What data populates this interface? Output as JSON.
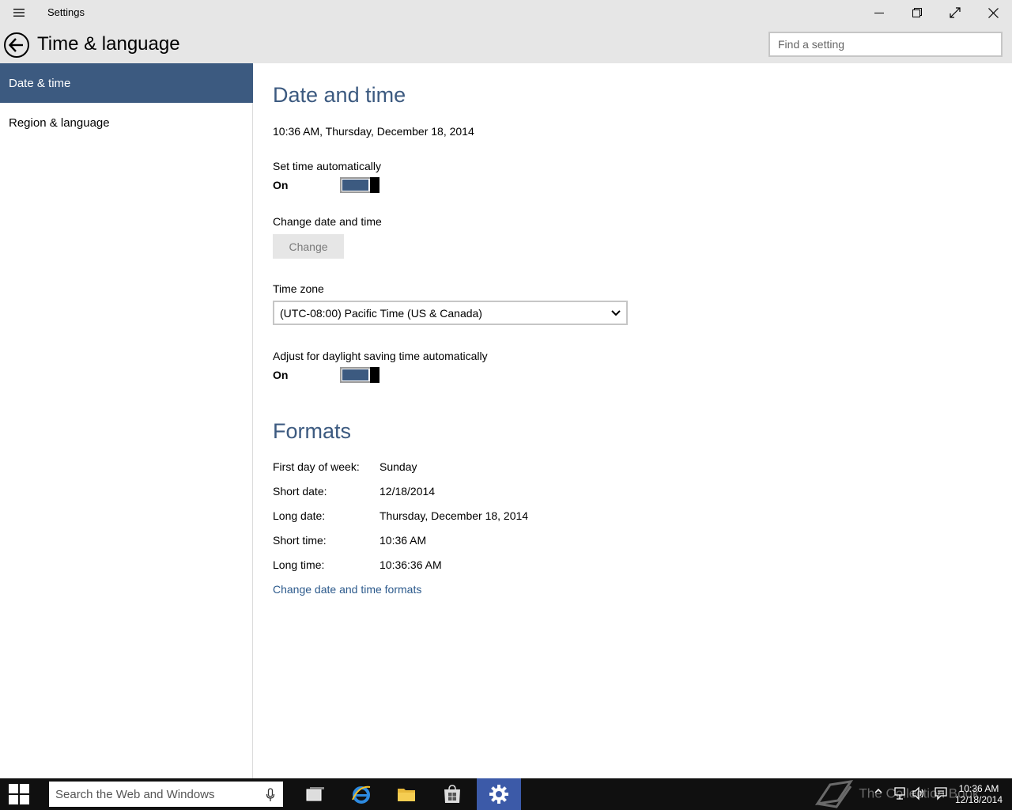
{
  "window": {
    "app_title": "Settings"
  },
  "header": {
    "page_title": "Time & language",
    "search_placeholder": "Find a setting"
  },
  "sidebar": {
    "items": [
      {
        "label": "Date & time",
        "active": true
      },
      {
        "label": "Region & language",
        "active": false
      }
    ]
  },
  "date_time": {
    "section_title": "Date and time",
    "current": "10:36 AM, Thursday, December 18, 2014",
    "set_time_auto": {
      "label": "Set time automatically",
      "state": "On"
    },
    "change_date_time": {
      "label": "Change date and time",
      "button": "Change"
    },
    "time_zone": {
      "label": "Time zone",
      "value": "(UTC-08:00) Pacific Time (US & Canada)"
    },
    "daylight": {
      "label": "Adjust for daylight saving time automatically",
      "state": "On"
    }
  },
  "formats": {
    "section_title": "Formats",
    "rows": [
      {
        "key": "First day of week:",
        "value": "Sunday"
      },
      {
        "key": "Short date:",
        "value": "12/18/2014"
      },
      {
        "key": "Long date:",
        "value": "Thursday, December 18, 2014"
      },
      {
        "key": "Short time:",
        "value": "10:36 AM"
      },
      {
        "key": "Long time:",
        "value": "10:36:36 AM"
      }
    ],
    "link": "Change date and time formats"
  },
  "taskbar": {
    "search_placeholder": "Search the Web and Windows",
    "clock_time": "10:36 AM",
    "clock_date": "12/18/2014",
    "watermark": "The Collection Book"
  },
  "colors": {
    "accent": "#3c5a80",
    "titlebar": "#e6e6e6",
    "taskbar": "#101010",
    "taskbar_active": "#3c5aa8"
  }
}
